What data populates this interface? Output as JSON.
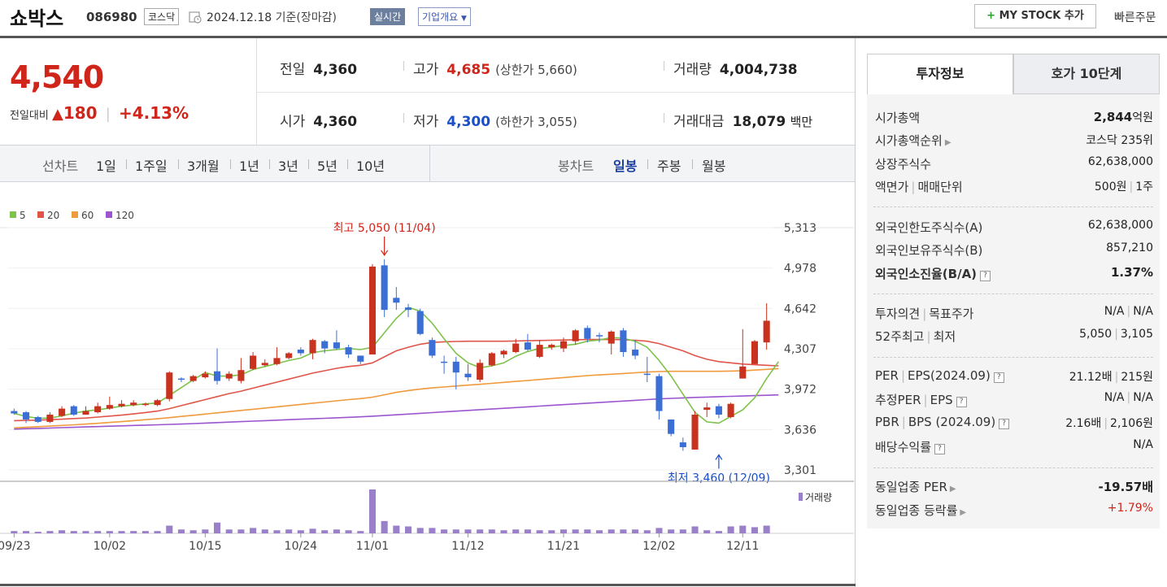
{
  "header": {
    "name": "쇼박스",
    "code": "086980",
    "market": "코스닥",
    "date": "2024.12.18",
    "date_note": "기준(장마감)",
    "live_label": "실시간",
    "corp_label": "기업개요",
    "mystock_plus": "+",
    "mystock_label": "MY STOCK 추가",
    "quick_order": "빠른주문"
  },
  "price": {
    "current": "4,540",
    "change_label": "전일대비",
    "change_arrow": "▲",
    "change_abs": "180",
    "change_pct": "+4.13%"
  },
  "stats": {
    "prev_label": "전일",
    "prev": "4,360",
    "high_label": "고가",
    "high": "4,685",
    "upper_limit": "(상한가 5,660)",
    "volume_label": "거래량",
    "volume": "4,004,738",
    "open_label": "시가",
    "open": "4,360",
    "low_label": "저가",
    "low": "4,300",
    "lower_limit": "(하한가 3,055)",
    "amount_label": "거래대금",
    "amount": "18,079",
    "amount_unit": "백만"
  },
  "chart_tabs": {
    "line_label": "선차트",
    "periods": [
      "1일",
      "1주일",
      "3개월",
      "1년",
      "3년",
      "5년",
      "10년"
    ],
    "candle_label": "봉차트",
    "candles": [
      "일봉",
      "주봉",
      "월봉"
    ],
    "active_candle": 0
  },
  "chart_data": {
    "type": "candlestick",
    "legend": [
      {
        "name": "5",
        "color": "#7dc24a"
      },
      {
        "name": "20",
        "color": "#e0554a"
      },
      {
        "name": "60",
        "color": "#ef9a3c"
      },
      {
        "name": "120",
        "color": "#9a55cf"
      }
    ],
    "y_ticks": [
      "5,313",
      "4,978",
      "4,642",
      "4,307",
      "3,972",
      "3,636",
      "3,301"
    ],
    "y_tick_values": [
      5313,
      4978,
      4642,
      4307,
      3972,
      3636,
      3301
    ],
    "ylim": [
      3301,
      5313
    ],
    "x_ticks": [
      "09/23",
      "10/02",
      "10/15",
      "10/24",
      "11/01",
      "11/12",
      "11/21",
      "12/02",
      "12/11"
    ],
    "x_tick_index": [
      0,
      8,
      16,
      24,
      30,
      38,
      46,
      54,
      61
    ],
    "high_annotation": "최고 5,050 (11/04)",
    "high_index": 31,
    "high_value": 5050,
    "low_annotation": "최저 3,460 (12/09)",
    "low_index": 59,
    "low_value": 3460,
    "volume_label": "거래량",
    "up_color": "#c8321e",
    "down_color": "#3b6fd6",
    "candles": [
      {
        "o": 3790,
        "h": 3810,
        "l": 3760,
        "c": 3770
      },
      {
        "o": 3780,
        "h": 3790,
        "l": 3690,
        "c": 3720
      },
      {
        "o": 3740,
        "h": 3750,
        "l": 3690,
        "c": 3700
      },
      {
        "o": 3700,
        "h": 3780,
        "l": 3690,
        "c": 3760
      },
      {
        "o": 3750,
        "h": 3830,
        "l": 3740,
        "c": 3810
      },
      {
        "o": 3830,
        "h": 3840,
        "l": 3750,
        "c": 3760
      },
      {
        "o": 3760,
        "h": 3830,
        "l": 3760,
        "c": 3790
      },
      {
        "o": 3780,
        "h": 3860,
        "l": 3770,
        "c": 3830
      },
      {
        "o": 3810,
        "h": 3910,
        "l": 3800,
        "c": 3840
      },
      {
        "o": 3830,
        "h": 3880,
        "l": 3820,
        "c": 3850
      },
      {
        "o": 3840,
        "h": 3880,
        "l": 3830,
        "c": 3860
      },
      {
        "o": 3840,
        "h": 3860,
        "l": 3830,
        "c": 3850
      },
      {
        "o": 3840,
        "h": 3890,
        "l": 3830,
        "c": 3880
      },
      {
        "o": 3890,
        "h": 4120,
        "l": 3870,
        "c": 4110
      },
      {
        "o": 4060,
        "h": 4070,
        "l": 4030,
        "c": 4050
      },
      {
        "o": 4040,
        "h": 4090,
        "l": 4030,
        "c": 4080
      },
      {
        "o": 4070,
        "h": 4120,
        "l": 4060,
        "c": 4100
      },
      {
        "o": 4120,
        "h": 4310,
        "l": 4010,
        "c": 4040
      },
      {
        "o": 4060,
        "h": 4120,
        "l": 4040,
        "c": 4100
      },
      {
        "o": 4040,
        "h": 4230,
        "l": 4020,
        "c": 4130
      },
      {
        "o": 4140,
        "h": 4280,
        "l": 4130,
        "c": 4250
      },
      {
        "o": 4170,
        "h": 4220,
        "l": 4160,
        "c": 4190
      },
      {
        "o": 4180,
        "h": 4320,
        "l": 4170,
        "c": 4230
      },
      {
        "o": 4230,
        "h": 4280,
        "l": 4220,
        "c": 4270
      },
      {
        "o": 4300,
        "h": 4320,
        "l": 4250,
        "c": 4270
      },
      {
        "o": 4270,
        "h": 4390,
        "l": 4220,
        "c": 4380
      },
      {
        "o": 4370,
        "h": 4380,
        "l": 4270,
        "c": 4310
      },
      {
        "o": 4360,
        "h": 4460,
        "l": 4300,
        "c": 4310
      },
      {
        "o": 4320,
        "h": 4340,
        "l": 4230,
        "c": 4260
      },
      {
        "o": 4250,
        "h": 4250,
        "l": 4180,
        "c": 4200
      },
      {
        "o": 4260,
        "h": 5010,
        "l": 4260,
        "c": 4990
      },
      {
        "o": 5000,
        "h": 5050,
        "l": 4570,
        "c": 4630
      },
      {
        "o": 4730,
        "h": 4820,
        "l": 4630,
        "c": 4690
      },
      {
        "o": 4650,
        "h": 4680,
        "l": 4570,
        "c": 4630
      },
      {
        "o": 4620,
        "h": 4640,
        "l": 4420,
        "c": 4430
      },
      {
        "o": 4380,
        "h": 4400,
        "l": 4230,
        "c": 4250
      },
      {
        "o": 4200,
        "h": 4250,
        "l": 4100,
        "c": 4190
      },
      {
        "o": 4200,
        "h": 4240,
        "l": 3970,
        "c": 4110
      },
      {
        "o": 4100,
        "h": 4180,
        "l": 4040,
        "c": 4070
      },
      {
        "o": 4050,
        "h": 4220,
        "l": 4030,
        "c": 4190
      },
      {
        "o": 4170,
        "h": 4280,
        "l": 4160,
        "c": 4270
      },
      {
        "o": 4260,
        "h": 4300,
        "l": 4230,
        "c": 4290
      },
      {
        "o": 4280,
        "h": 4390,
        "l": 4270,
        "c": 4350
      },
      {
        "o": 4360,
        "h": 4430,
        "l": 4290,
        "c": 4300
      },
      {
        "o": 4240,
        "h": 4380,
        "l": 4230,
        "c": 4340
      },
      {
        "o": 4320,
        "h": 4350,
        "l": 4300,
        "c": 4340
      },
      {
        "o": 4310,
        "h": 4400,
        "l": 4280,
        "c": 4370
      },
      {
        "o": 4370,
        "h": 4470,
        "l": 4340,
        "c": 4460
      },
      {
        "o": 4480,
        "h": 4500,
        "l": 4360,
        "c": 4390
      },
      {
        "o": 4420,
        "h": 4440,
        "l": 4360,
        "c": 4410
      },
      {
        "o": 4350,
        "h": 4460,
        "l": 4260,
        "c": 4450
      },
      {
        "o": 4460,
        "h": 4480,
        "l": 4240,
        "c": 4280
      },
      {
        "o": 4300,
        "h": 4380,
        "l": 4220,
        "c": 4250
      },
      {
        "o": 4100,
        "h": 4240,
        "l": 4030,
        "c": 4090
      },
      {
        "o": 4080,
        "h": 4100,
        "l": 3720,
        "c": 3790
      },
      {
        "o": 3720,
        "h": 3720,
        "l": 3580,
        "c": 3600
      },
      {
        "o": 3530,
        "h": 3570,
        "l": 3460,
        "c": 3490
      },
      {
        "o": 3470,
        "h": 3790,
        "l": 3470,
        "c": 3760
      },
      {
        "o": 3800,
        "h": 3860,
        "l": 3740,
        "c": 3820
      },
      {
        "o": 3830,
        "h": 3850,
        "l": 3730,
        "c": 3760
      },
      {
        "o": 3740,
        "h": 3860,
        "l": 3730,
        "c": 3850
      },
      {
        "o": 4060,
        "h": 4470,
        "l": 4060,
        "c": 4160
      },
      {
        "o": 4180,
        "h": 4380,
        "l": 4180,
        "c": 4370
      },
      {
        "o": 4360,
        "h": 4685,
        "l": 4300,
        "c": 4540
      }
    ],
    "volume": [
      3,
      3,
      2,
      3,
      4,
      3,
      3,
      3,
      3,
      3,
      3,
      3,
      3,
      10,
      5,
      4,
      5,
      14,
      5,
      5,
      7,
      5,
      4,
      5,
      4,
      6,
      4,
      5,
      4,
      3,
      57,
      16,
      10,
      9,
      7,
      7,
      5,
      5,
      5,
      5,
      5,
      4,
      5,
      5,
      4,
      4,
      5,
      5,
      5,
      4,
      5,
      5,
      5,
      4,
      7,
      5,
      5,
      9,
      4,
      3,
      9,
      10,
      8,
      10
    ],
    "ma5": [
      3770,
      3745,
      3730,
      3732,
      3750,
      3772,
      3790,
      3800,
      3815,
      3830,
      3840,
      3850,
      3856,
      3920,
      3985,
      4050,
      4110,
      4080,
      4080,
      4090,
      4135,
      4160,
      4185,
      4210,
      4230,
      4275,
      4290,
      4300,
      4310,
      4300,
      4320,
      4440,
      4560,
      4650,
      4620,
      4520,
      4390,
      4270,
      4190,
      4150,
      4165,
      4190,
      4245,
      4285,
      4310,
      4320,
      4335,
      4345,
      4370,
      4380,
      4400,
      4395,
      4370,
      4320,
      4210,
      4080,
      3930,
      3780,
      3700,
      3690,
      3745,
      3800,
      3900,
      4060,
      4200
    ],
    "ma20": [
      3710,
      3712,
      3714,
      3718,
      3722,
      3728,
      3732,
      3740,
      3748,
      3756,
      3766,
      3778,
      3790,
      3810,
      3835,
      3860,
      3885,
      3910,
      3935,
      3955,
      3980,
      4005,
      4030,
      4055,
      4080,
      4105,
      4125,
      4145,
      4160,
      4170,
      4190,
      4240,
      4290,
      4320,
      4345,
      4360,
      4365,
      4368,
      4370,
      4370,
      4370,
      4370,
      4372,
      4374,
      4376,
      4378,
      4380,
      4382,
      4384,
      4384,
      4384,
      4382,
      4378,
      4370,
      4350,
      4320,
      4290,
      4250,
      4220,
      4200,
      4190,
      4180,
      4175,
      4170,
      4165
    ],
    "ma60": [
      3650,
      3655,
      3660,
      3665,
      3670,
      3676,
      3682,
      3688,
      3695,
      3702,
      3710,
      3718,
      3726,
      3735,
      3745,
      3755,
      3765,
      3775,
      3785,
      3795,
      3805,
      3815,
      3825,
      3835,
      3845,
      3855,
      3865,
      3875,
      3885,
      3893,
      3905,
      3925,
      3945,
      3960,
      3972,
      3982,
      3990,
      3998,
      4005,
      4012,
      4020,
      4028,
      4036,
      4044,
      4052,
      4060,
      4068,
      4076,
      4084,
      4090,
      4096,
      4102,
      4108,
      4114,
      4118,
      4120,
      4120,
      4120,
      4120,
      4120,
      4122,
      4124,
      4130,
      4136,
      4142
    ],
    "ma120": [
      3640,
      3643,
      3646,
      3649,
      3652,
      3655,
      3658,
      3661,
      3664,
      3667,
      3670,
      3673,
      3676,
      3679,
      3682,
      3686,
      3690,
      3694,
      3698,
      3702,
      3706,
      3710,
      3714,
      3718,
      3722,
      3726,
      3730,
      3734,
      3738,
      3742,
      3747,
      3753,
      3759,
      3765,
      3771,
      3777,
      3783,
      3789,
      3795,
      3801,
      3807,
      3813,
      3819,
      3825,
      3831,
      3837,
      3843,
      3849,
      3855,
      3861,
      3867,
      3873,
      3879,
      3885,
      3891,
      3895,
      3899,
      3903,
      3906,
      3909,
      3912,
      3915,
      3918,
      3921,
      3924
    ]
  },
  "right_panel": {
    "tab_active": "투자정보",
    "tab_other": "호가 10단계",
    "market_cap_label": "시가총액",
    "market_cap": "2,844",
    "market_cap_unit": "억원",
    "cap_rank_label": "시가총액순위",
    "cap_rank": "코스닥 235위",
    "shares_label": "상장주식수",
    "shares": "62,638,000",
    "par_label": "액면가",
    "unit_label": "매매단위",
    "par": "500원",
    "unit": "1주",
    "foreign_limit_label": "외국인한도주식수(A)",
    "foreign_limit": "62,638,000",
    "foreign_hold_label": "외국인보유주식수(B)",
    "foreign_hold": "857,210",
    "foreign_rate_label": "외국인소진율(B/A)",
    "foreign_rate": "1.37%",
    "opinion_label": "투자의견",
    "target_label": "목표주가",
    "opinion": "N/A",
    "target": "N/A",
    "w52_high_label": "52주최고",
    "w52_low_label": "최저",
    "w52_high": "5,050",
    "w52_low": "3,105",
    "per_label": "PER",
    "eps_label": "EPS(2024.09)",
    "per": "21.12배",
    "eps": "215원",
    "est_per_label": "추정PER",
    "est_eps_label": "EPS",
    "est_per": "N/A",
    "est_eps": "N/A",
    "pbr_label": "PBR",
    "bps_label": "BPS (2024.09)",
    "pbr": "2.16배",
    "bps": "2,106원",
    "div_label": "배당수익률",
    "div": "N/A",
    "ind_per_label": "동일업종 PER",
    "ind_per": "-19.57배",
    "ind_rate_label": "동일업종 등락률",
    "ind_rate": "+1.79%"
  }
}
